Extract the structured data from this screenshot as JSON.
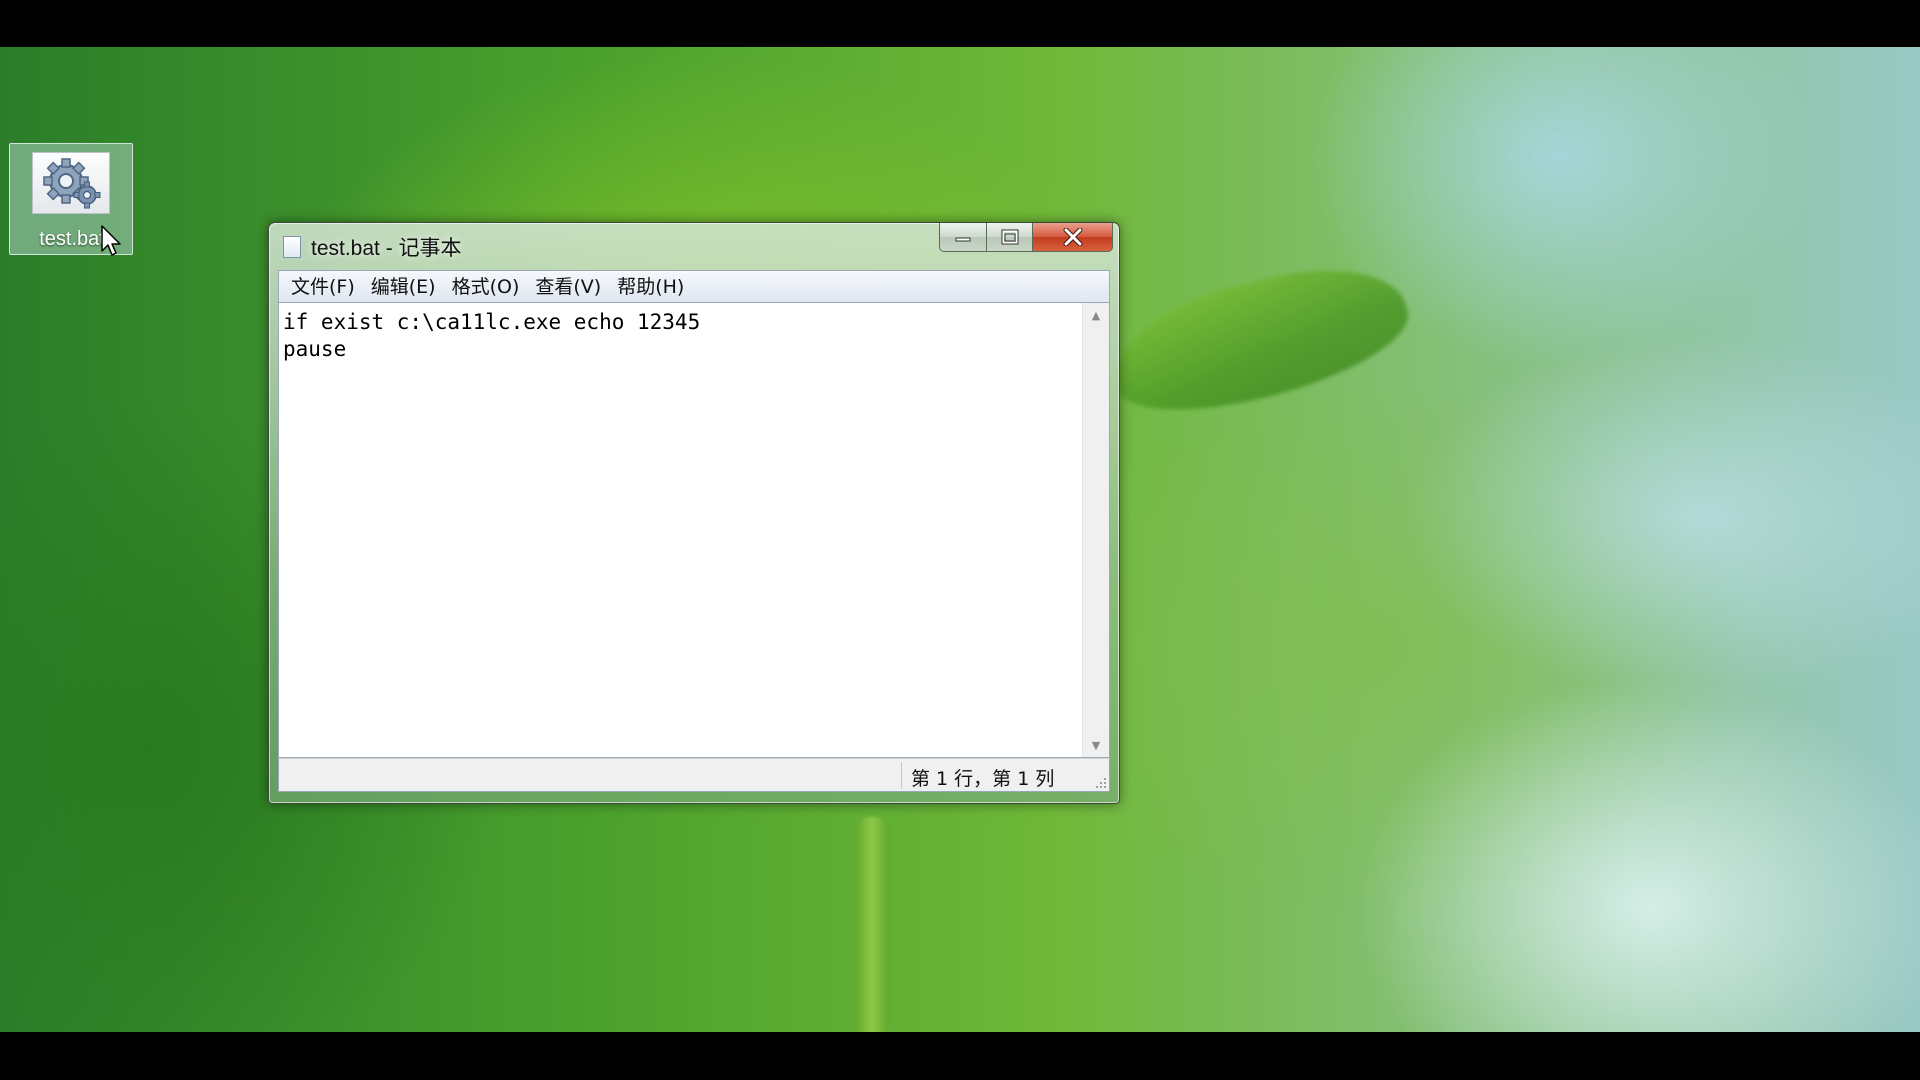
{
  "desktop": {
    "icons": [
      {
        "label": "test.bat",
        "icon": "gear-batch-file-icon"
      }
    ]
  },
  "window": {
    "title": "test.bat - 记事本",
    "icon": "notepad-icon",
    "controls": {
      "minimize": "minimize-icon",
      "maximize": "maximize-icon",
      "close": "close-icon"
    },
    "menu": [
      {
        "label": "文件(F)"
      },
      {
        "label": "编辑(E)"
      },
      {
        "label": "格式(O)"
      },
      {
        "label": "查看(V)"
      },
      {
        "label": "帮助(H)"
      }
    ],
    "content": "if exist c:\\ca11lc.exe echo 12345\npause",
    "status": {
      "position": "第 1 行，第 1 列"
    }
  }
}
